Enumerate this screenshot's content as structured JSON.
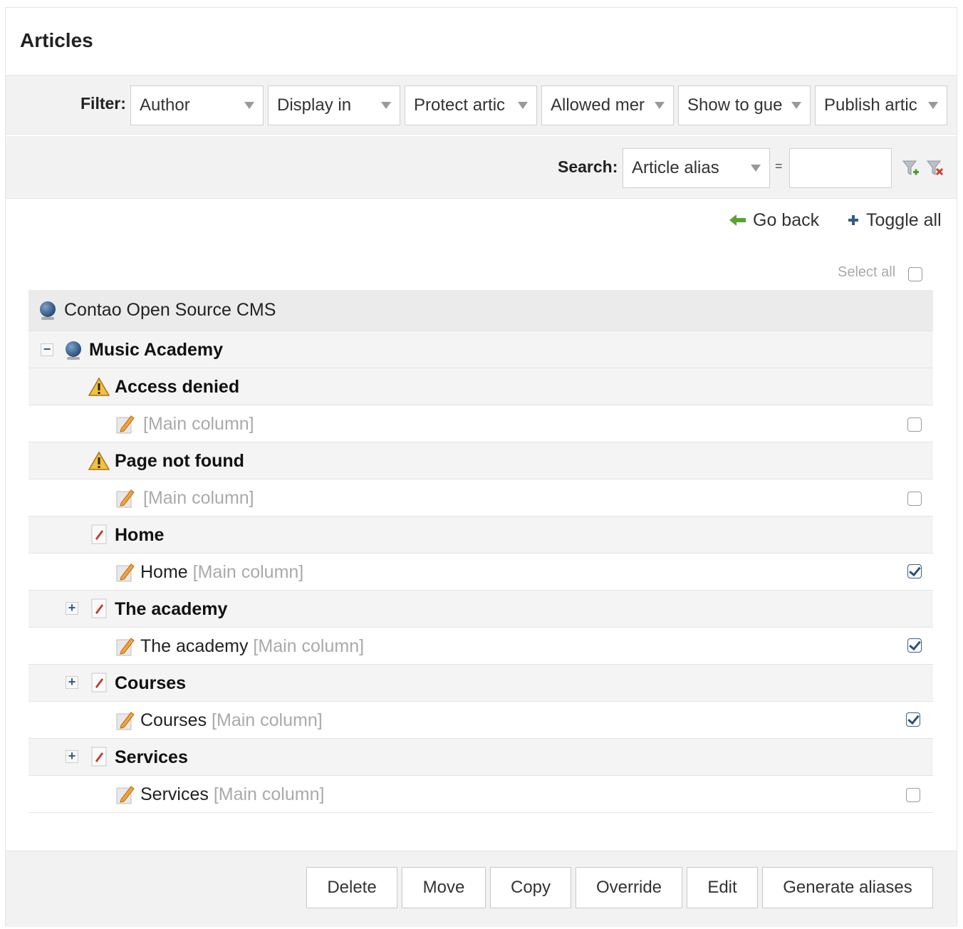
{
  "header": {
    "title": "Articles"
  },
  "filter": {
    "label": "Filter:",
    "selects": [
      "Author",
      "Display in",
      "Protect artic",
      "Allowed mer",
      "Show to gue",
      "Publish artic"
    ]
  },
  "search": {
    "label": "Search:",
    "field": "Article alias",
    "operator": "=",
    "value": ""
  },
  "nav": {
    "go_back": "Go back",
    "toggle_all": "Toggle all"
  },
  "select_all": "Select all",
  "tree": {
    "root": "Contao Open Source CMS",
    "site": "Music Academy",
    "pages": [
      {
        "title": "Access denied",
        "icon": "warning-icon",
        "article_title": "",
        "section": "[Main column]",
        "checked": false,
        "expandable": false
      },
      {
        "title": "Page not found",
        "icon": "warning-icon",
        "article_title": "",
        "section": "[Main column]",
        "checked": false,
        "expandable": false
      },
      {
        "title": "Home",
        "icon": "page-icon",
        "article_title": "Home",
        "section": "[Main column]",
        "checked": true,
        "expandable": false
      },
      {
        "title": "The academy",
        "icon": "page-icon",
        "article_title": "The academy",
        "section": "[Main column]",
        "checked": true,
        "expandable": true
      },
      {
        "title": "Courses",
        "icon": "page-icon",
        "article_title": "Courses",
        "section": "[Main column]",
        "checked": true,
        "expandable": true
      },
      {
        "title": "Services",
        "icon": "page-icon",
        "article_title": "Services",
        "section": "[Main column]",
        "checked": false,
        "expandable": true
      }
    ]
  },
  "footer": {
    "buttons": [
      "Delete",
      "Move",
      "Copy",
      "Override",
      "Edit",
      "Generate aliases"
    ]
  },
  "colors": {
    "accent": "#2c4f7c",
    "bar_bg": "#f2f2f2",
    "row_bg": "#f4f4f4"
  }
}
